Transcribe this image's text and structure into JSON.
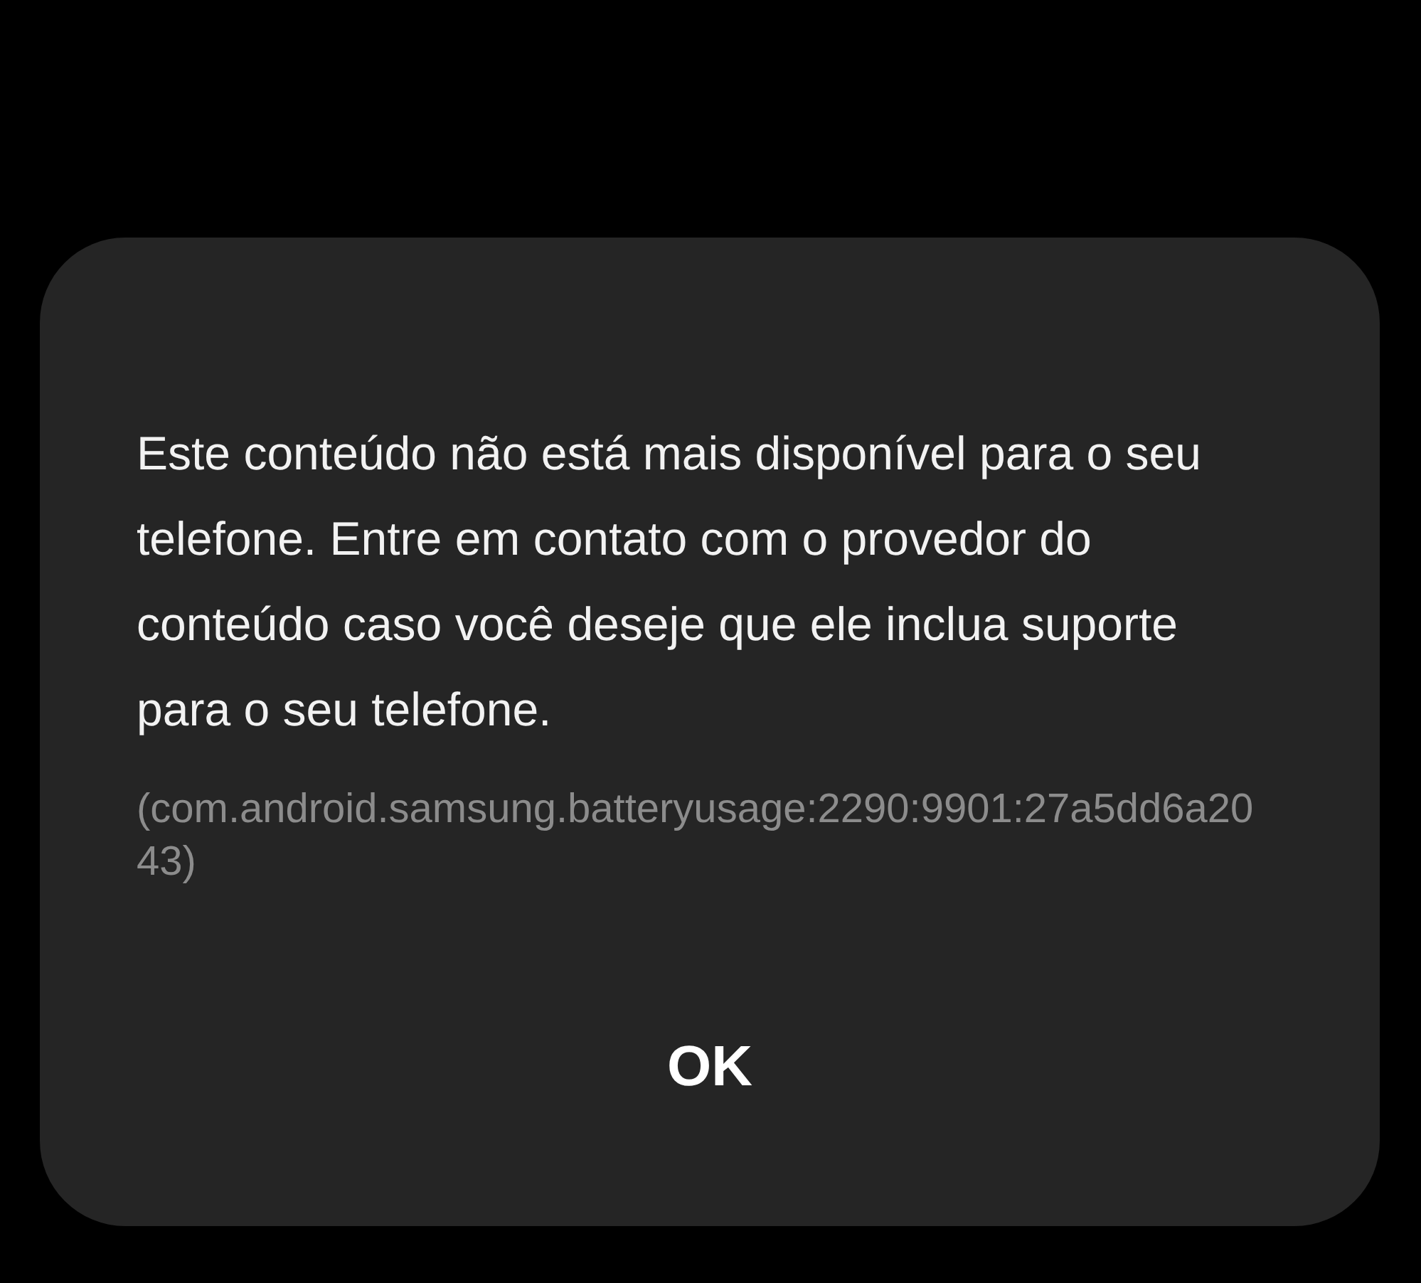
{
  "dialog": {
    "message": "Este conteúdo não está mais disponível para o seu telefone. Entre em contato com o provedor do conteúdo caso você deseje que ele inclua suporte para o seu telefone.",
    "detail": "(com.android.samsung.batteryusage:2290:9901:27a5dd6a2043)",
    "button": "OK"
  }
}
